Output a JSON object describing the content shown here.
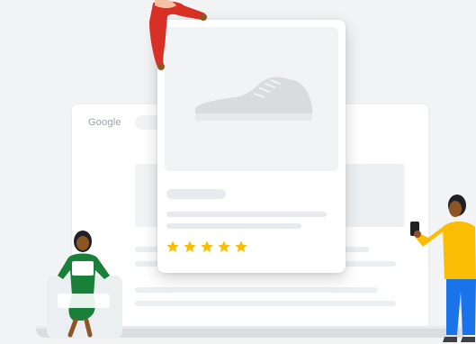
{
  "background_window": {
    "brand_text": "Google"
  },
  "product_card": {
    "rating": {
      "stars": 5,
      "max": 5
    }
  },
  "colors": {
    "background": "#f1f3f4",
    "card": "#ffffff",
    "star": "#fbbc04",
    "placeholder": "#e8eaed",
    "figure_red": "#d93025",
    "figure_green": "#188038",
    "figure_yellow": "#fbbc04",
    "figure_blue": "#1a73e8"
  },
  "icons": {
    "shoe": "shoe-icon",
    "star": "star-icon",
    "phone": "phone-icon",
    "laptop": "laptop-icon"
  }
}
